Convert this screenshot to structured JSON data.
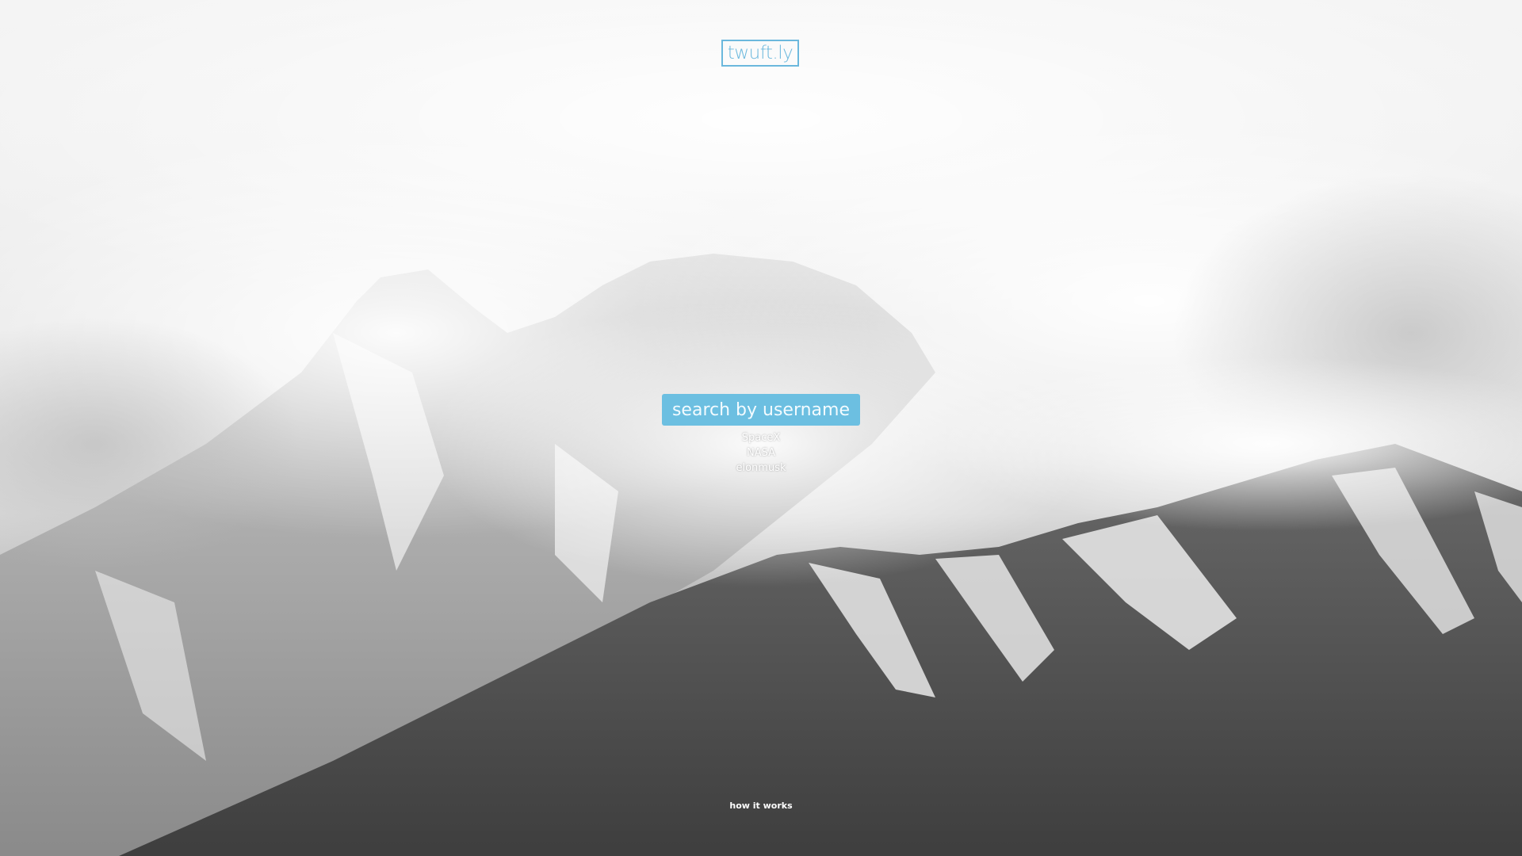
{
  "brand": {
    "logo_text": "twuft.ly",
    "accent_color": "#6bb8dd"
  },
  "search": {
    "placeholder": "search by username",
    "value": ""
  },
  "suggestions": [
    "SpaceX",
    "NASA",
    "elonmusk"
  ],
  "footer": {
    "how_it_works": "how it works"
  },
  "background": {
    "subject": "snow-covered-mountains-in-clouds"
  }
}
